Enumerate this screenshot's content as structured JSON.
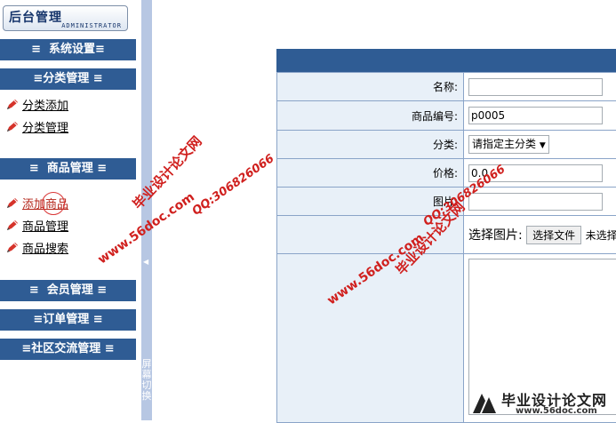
{
  "logo": {
    "title": "后台管理",
    "subtitle": "ADMINISTRATOR"
  },
  "sidebar": {
    "groups": [
      {
        "label": "≡  系统设置≡"
      },
      {
        "label": "≡分类管理 ≡"
      },
      {
        "label": "≡  商品管理 ≡"
      },
      {
        "label": "≡  会员管理 ≡"
      },
      {
        "label": "≡订单管理 ≡"
      },
      {
        "label": "≡社区交流管理 ≡"
      }
    ],
    "category_items": [
      {
        "label": "分类添加"
      },
      {
        "label": "分类管理"
      }
    ],
    "product_items": [
      {
        "label": "添加商品"
      },
      {
        "label": "商品管理"
      },
      {
        "label": "商品搜索"
      }
    ],
    "icon": "pencil-icon"
  },
  "splitter": {
    "label": "屏幕切换"
  },
  "form": {
    "name_label": "名称:",
    "name_value": "",
    "code_label": "商品编号:",
    "code_value": "p0005",
    "category_label": "分类:",
    "category_selected": "请指定主分类",
    "price_label": "价格:",
    "price_value": "0.0",
    "image_label": "图片:",
    "image_value": "",
    "file_label": "选择图片:",
    "file_button": "选择文件",
    "file_status": "未选择任何文件",
    "description_value": ""
  },
  "watermarks": {
    "site_name": "毕业设计论文网",
    "site_url": "www.56doc.com",
    "qq": "QQ:306826066",
    "badge_url": "www.56doc.com"
  },
  "colors": {
    "header_blue": "#2f5c94",
    "label_bg": "#e8f0f8",
    "border": "#8aa4c8",
    "splitter": "#b7c7e3",
    "watermark_red": "#d0201e"
  }
}
